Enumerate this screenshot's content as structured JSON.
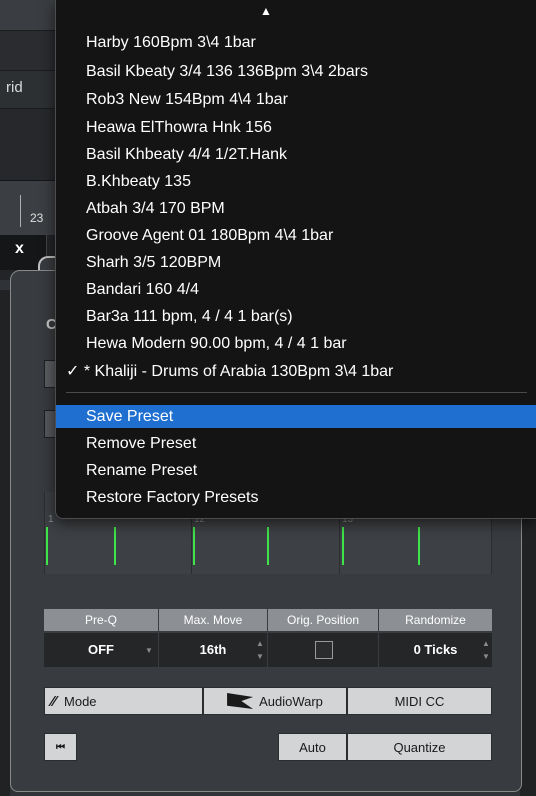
{
  "background": {
    "grid_label": "rid",
    "ruler_number": "23",
    "tab_close": "x",
    "panel_letter": "C"
  },
  "grid": {
    "bar_numbers": [
      "1",
      "12",
      "13"
    ]
  },
  "quantize": {
    "headers": [
      "Pre-Q",
      "Max. Move",
      "Orig. Position",
      "Randomize"
    ],
    "pre_q": "OFF",
    "max_move": "16th",
    "randomize": "0 Ticks"
  },
  "buttons": {
    "mode_icon": "⁄⁄",
    "mode": "Mode",
    "audiowarp": "AudioWarp",
    "midi_cc": "MIDI CC",
    "rewind_icon": "⏮",
    "auto": "Auto",
    "quantize": "Quantize"
  },
  "menu": {
    "presets": [
      "Harby  160Bpm  3\\4  1bar",
      "Basil Kbeaty 3/4 136  136Bpm  3\\4  2bars",
      "Rob3 New  154Bpm  4\\4  1bar",
      "Heawa ElThowra Hnk 156",
      "Basil Khbeaty 4/4 1/2T.Hank",
      "B.Khbeaty 135",
      "Atbah 3/4  170 BPM",
      "Groove Agent 01  180Bpm  4\\4  1bar",
      "Sharh 3/5 120BPM",
      "Bandari 160 4/4",
      "Bar3a 111 bpm, 4 / 4  1 bar(s)",
      "Hewa Modern 90.00 bpm, 4 / 4  1 bar",
      "✓ * Khaliji - Drums of Arabia  130Bpm  3\\4  1bar"
    ],
    "actions": [
      "Save Preset",
      "Remove Preset",
      "Rename Preset",
      "Restore Factory Presets"
    ],
    "arrow": "▲",
    "highlight_color": "#1e6fd0"
  }
}
